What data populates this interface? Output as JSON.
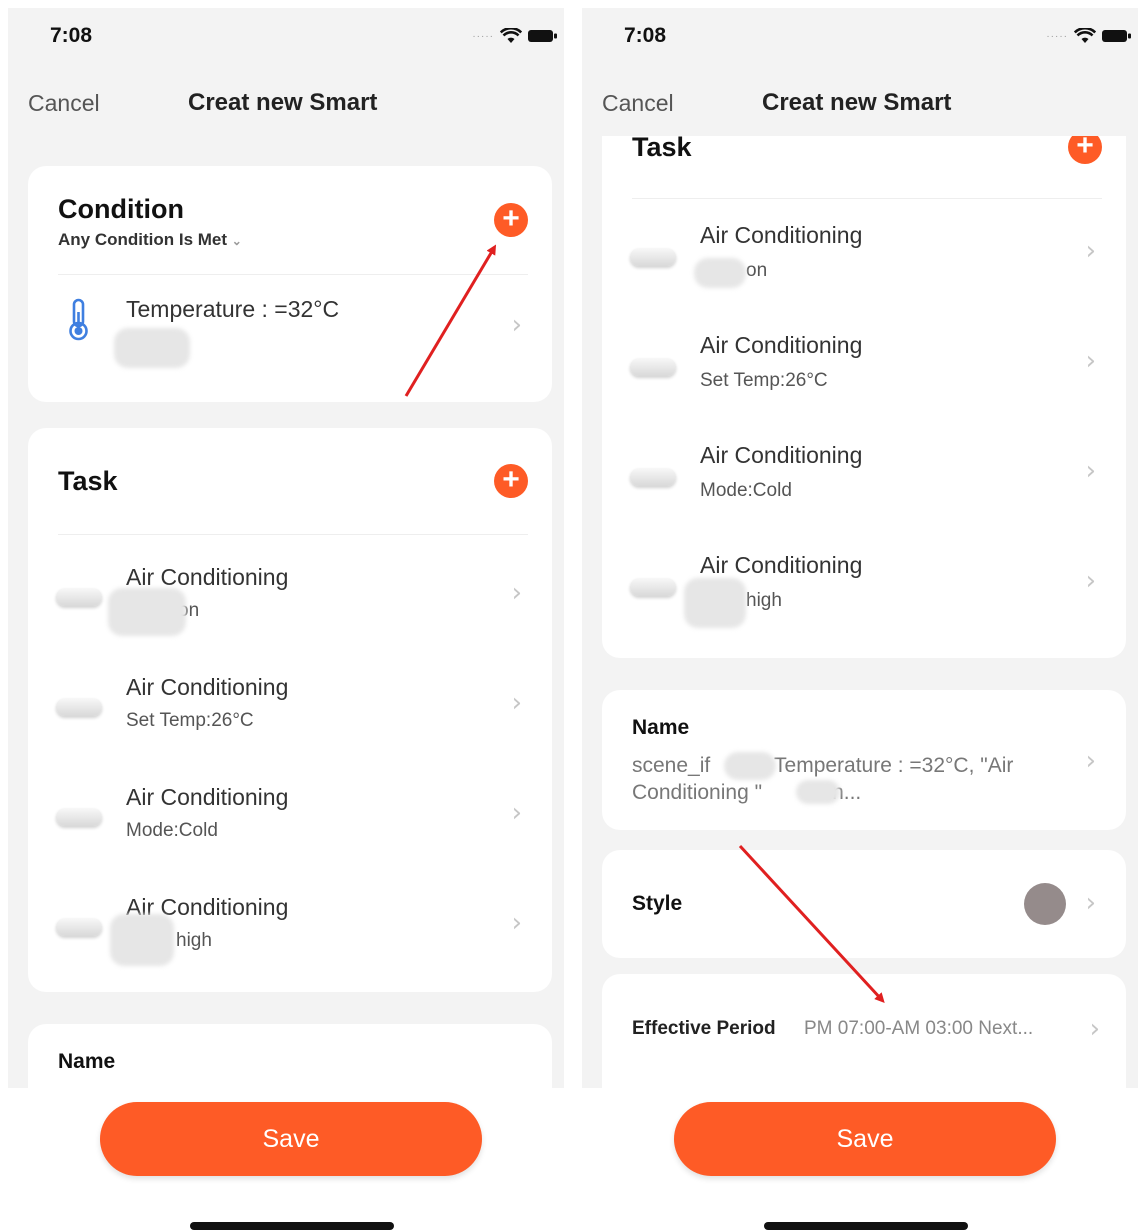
{
  "status": {
    "time": "7:08"
  },
  "nav": {
    "cancel": "Cancel",
    "title": "Creat new Smart"
  },
  "condition": {
    "title": "Condition",
    "mode": "Any Condition Is Met",
    "items": [
      {
        "title": "Temperature : =32°C"
      }
    ]
  },
  "task": {
    "title": "Task",
    "items": [
      {
        "title": "Air Conditioning",
        "sub": "on"
      },
      {
        "title": "Air Conditioning",
        "sub": "Set Temp:26°C"
      },
      {
        "title": "Air Conditioning",
        "sub": "Mode:Cold"
      },
      {
        "title": "Air Conditioning",
        "sub": "high"
      }
    ]
  },
  "name": {
    "label": "Name",
    "value_line1": "scene_if           Temperature : =32°C, \"Air",
    "value_line2": "Conditioning \"          on..."
  },
  "style": {
    "label": "Style",
    "color": "#958b8b"
  },
  "effective_period": {
    "label": "Effective Period",
    "value": "PM 07:00-AM 03:00 Next..."
  },
  "save_label": "Save",
  "colors": {
    "accent": "#fe5b26",
    "annotation_arrow": "#e02020"
  },
  "icons": [
    "plus-icon",
    "chevron-right-icon",
    "thermometer-icon",
    "air-conditioner-icon",
    "wifi-icon",
    "battery-icon"
  ]
}
